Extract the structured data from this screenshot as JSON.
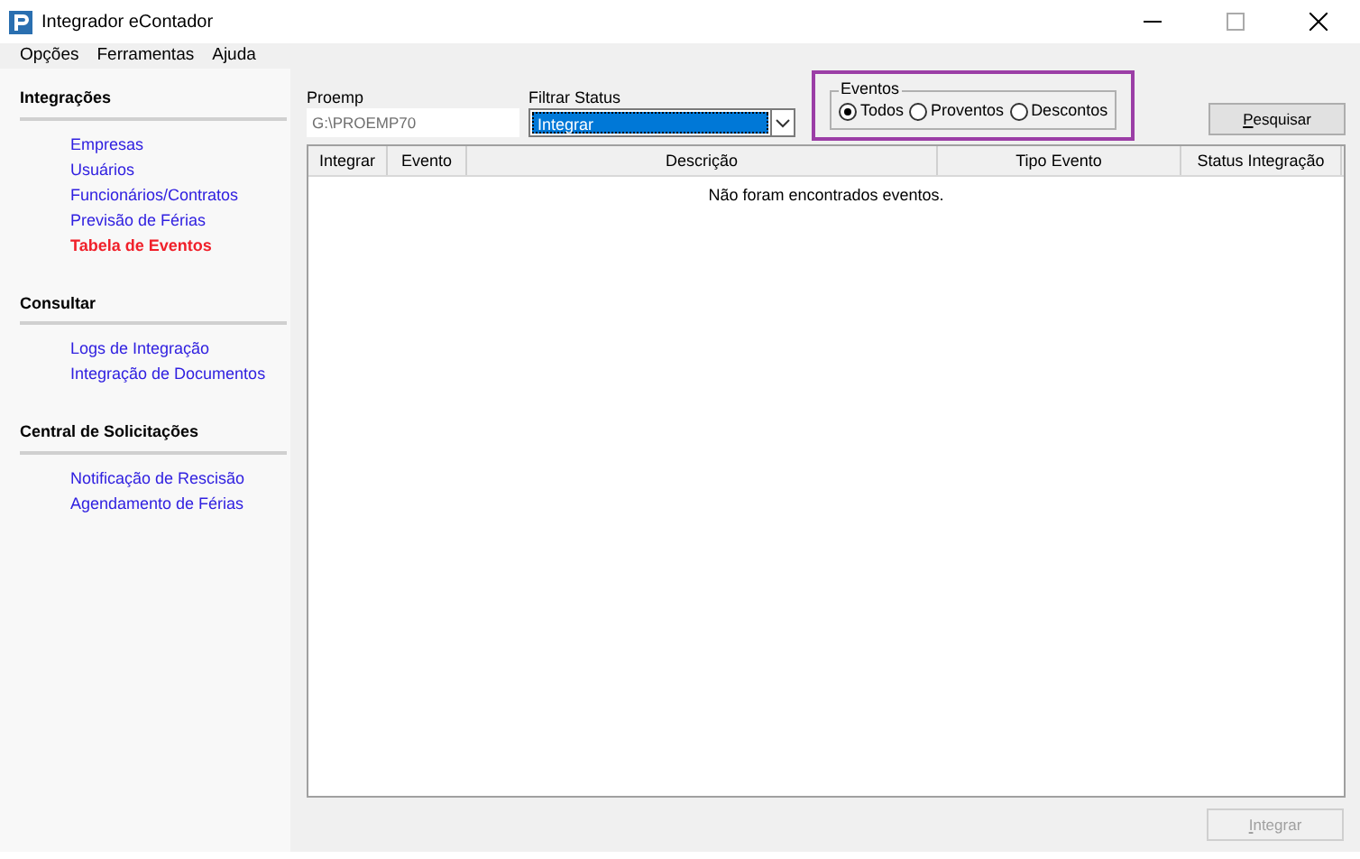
{
  "window": {
    "title": "Integrador eContador"
  },
  "menu": [
    "Opções",
    "Ferramentas",
    "Ajuda"
  ],
  "sidebar": {
    "sections": [
      {
        "title": "Integrações",
        "items": [
          {
            "label": "Empresas",
            "selected": false
          },
          {
            "label": "Usuários",
            "selected": false
          },
          {
            "label": "Funcionários/Contratos",
            "selected": false
          },
          {
            "label": "Previsão de Férias",
            "selected": false
          },
          {
            "label": "Tabela de Eventos",
            "selected": true
          }
        ]
      },
      {
        "title": "Consultar",
        "items": [
          {
            "label": "Logs de Integração",
            "selected": false
          },
          {
            "label": "Integração de Documentos",
            "selected": false
          }
        ]
      },
      {
        "title": "Central de Solicitações",
        "items": [
          {
            "label": "Notificação de Rescisão",
            "selected": false
          },
          {
            "label": "Agendamento de Férias",
            "selected": false
          }
        ]
      }
    ]
  },
  "proemp": {
    "label": "Proemp",
    "value": "G:\\PROEMP70",
    "disabled": true
  },
  "status_filter": {
    "label": "Filtrar Status",
    "value": "Integrar"
  },
  "eventos": {
    "label": "Eventos",
    "highlighted": true,
    "options": [
      {
        "label": "Todos",
        "selected": true
      },
      {
        "label": "Proventos",
        "selected": false
      },
      {
        "label": "Descontos",
        "selected": false
      }
    ]
  },
  "search_button": {
    "label": "Pesquisar",
    "disabled": false
  },
  "table": {
    "columns": [
      "Integrar",
      "Evento",
      "Descrição",
      "Tipo Evento",
      "Status Integração"
    ],
    "empty_message": "Não foram encontrados eventos."
  },
  "integrate_button": {
    "label": "Integrar",
    "disabled": true
  }
}
